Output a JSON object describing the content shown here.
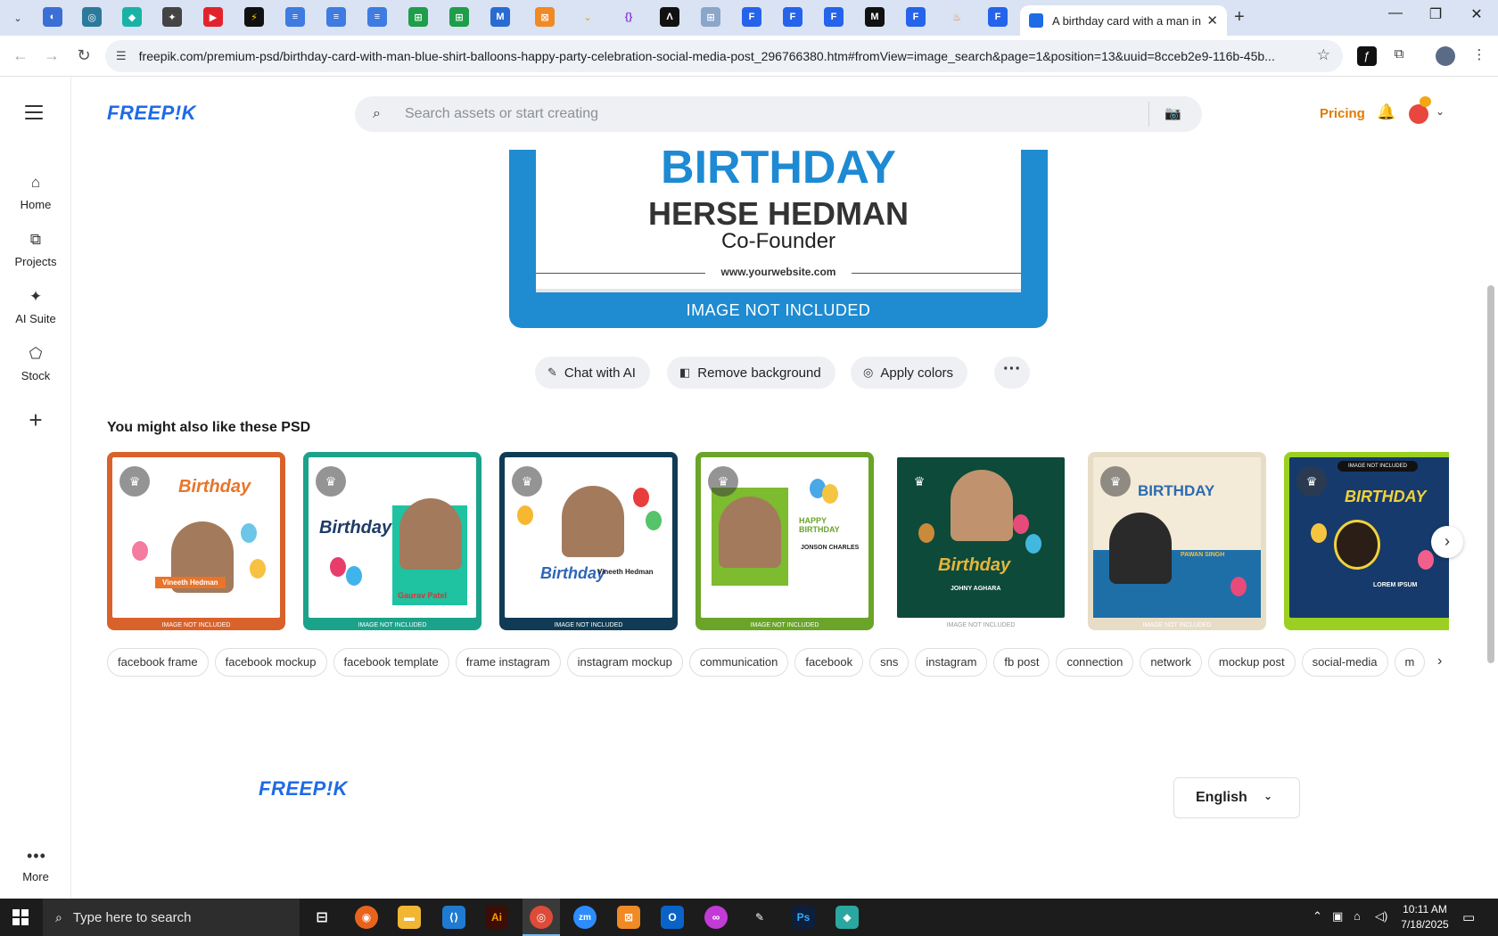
{
  "browser": {
    "active_tab_title": "A birthday card with a man in a blue shirt",
    "url": "freepik.com/premium-psd/birthday-card-with-man-blue-shirt-balloons-happy-party-celebration-social-media-post_296766380.htm#fromView=image_search&page=1&position=13&uuid=8cceb2e9-116b-45b...",
    "new_tab": "+",
    "minimize": "—",
    "restore": "❐",
    "close": "✕"
  },
  "header": {
    "logo": "FREEP!K",
    "search_placeholder": "Search assets or start creating",
    "pricing": "Pricing"
  },
  "sidebar": {
    "items": [
      {
        "label": "Home",
        "icon": "home-icon"
      },
      {
        "label": "Projects",
        "icon": "projects-icon"
      },
      {
        "label": "AI Suite",
        "icon": "sparkle-icon"
      },
      {
        "label": "Stock",
        "icon": "stock-icon"
      }
    ],
    "more_label": "More"
  },
  "preview": {
    "headline": "BIRTHDAY",
    "name": "HERSE HEDMAN",
    "role": "Co-Founder",
    "website": "www.yourwebsite.com",
    "notice": "IMAGE NOT INCLUDED"
  },
  "actions": {
    "chat": "Chat with AI",
    "remove_bg": "Remove background",
    "apply_colors": "Apply colors"
  },
  "related": {
    "title": "You might also like these PSD",
    "items": [
      {
        "frame": "#d9622b",
        "headline": "Birthday",
        "name": "Vineeth Hedman"
      },
      {
        "frame": "#1aa38a",
        "headline": "Birthday",
        "name": "Gaurav Patel"
      },
      {
        "frame": "#0f3b55",
        "headline": "Birthday",
        "name": "Vineeth Hedman"
      },
      {
        "frame": "#6aa428",
        "headline": "HAPPY BIRTHDAY",
        "name": "JONSON CHARLES"
      },
      {
        "frame": "#ffffff",
        "headline": "Birthday",
        "name": "JOHNY AGHARA"
      },
      {
        "frame": "#e7dcc6",
        "headline": "BIRTHDAY",
        "name": "PAWAN SINGH"
      },
      {
        "frame": "#9bd022",
        "headline": "BIRTHDAY",
        "name": "LOREM IPSUM"
      }
    ]
  },
  "tags": [
    "facebook frame",
    "facebook mockup",
    "facebook template",
    "frame instagram",
    "instagram mockup",
    "communication",
    "facebook",
    "sns",
    "instagram",
    "fb post",
    "connection",
    "network",
    "mockup post",
    "social-media",
    "m"
  ],
  "footer": {
    "logo": "FREEP!K",
    "language": "English"
  },
  "taskbar": {
    "search_text": "Type here to search",
    "time": "10:11 AM",
    "date": "7/18/2025"
  }
}
